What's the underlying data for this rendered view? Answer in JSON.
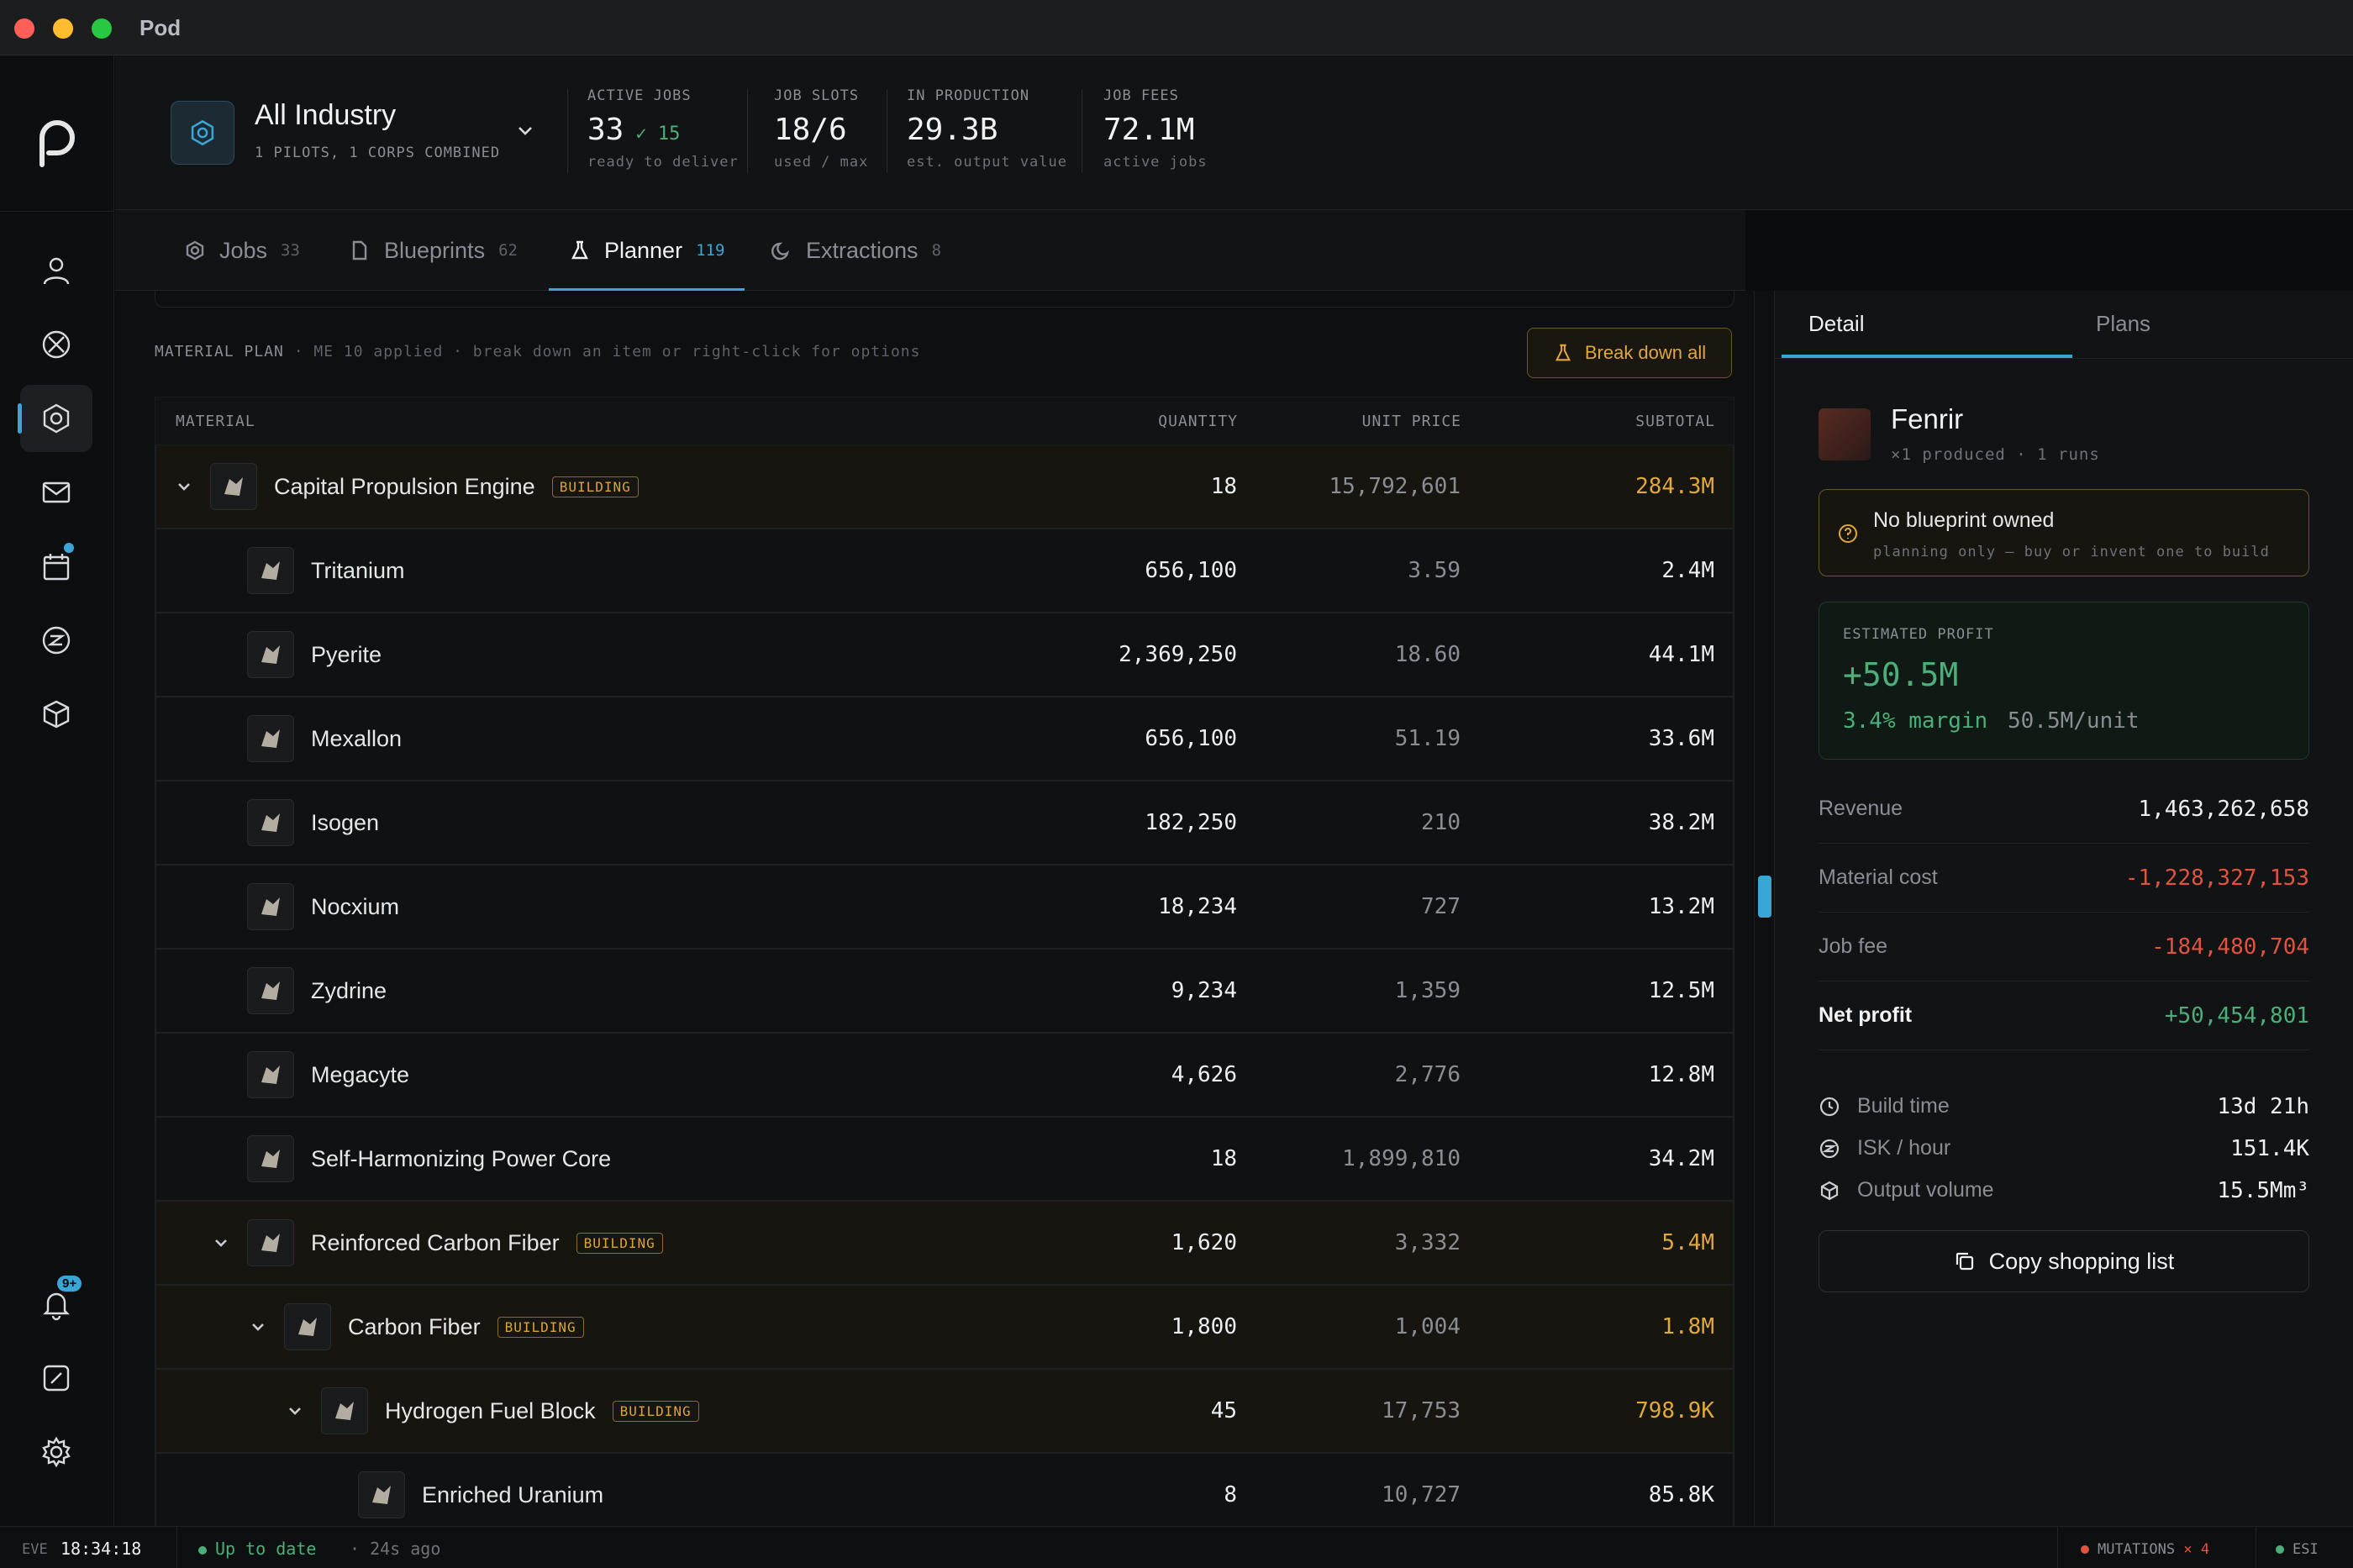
{
  "window": {
    "title": "Pod"
  },
  "header": {
    "scope_title": "All Industry",
    "scope_sub": "1 PILOTS, 1 CORPS COMBINED",
    "stats": [
      {
        "label": "ACTIVE JOBS",
        "value": "33",
        "extra": "✓ 15",
        "sub": "ready to deliver"
      },
      {
        "label": "JOB SLOTS",
        "value": "18/6",
        "sub": "used / max"
      },
      {
        "label": "IN PRODUCTION",
        "value": "29.3B",
        "sub": "est. output value"
      },
      {
        "label": "JOB FEES",
        "value": "72.1M",
        "sub": "active jobs"
      }
    ]
  },
  "tabs": [
    {
      "label": "Jobs",
      "count": "33",
      "icon": "gear-icon"
    },
    {
      "label": "Blueprints",
      "count": "62",
      "icon": "document-icon"
    },
    {
      "label": "Planner",
      "count": "119",
      "icon": "flask-icon",
      "active": true
    },
    {
      "label": "Extractions",
      "count": "8",
      "icon": "moon-icon"
    }
  ],
  "plan": {
    "caption_title": "MATERIAL PLAN",
    "caption_detail": "· ME 10 applied · break down an item or right-click for options",
    "breakdown_label": "Break down all",
    "columns": {
      "material": "MATERIAL",
      "quantity": "QUANTITY",
      "unit_price": "UNIT PRICE",
      "subtotal": "SUBTOTAL"
    },
    "building_tag": "BUILDING",
    "rows": [
      {
        "name": "Capital Propulsion Engine",
        "qty": "18",
        "price": "15,792,601",
        "subtotal": "284.3M",
        "level": 0,
        "building": true
      },
      {
        "name": "Tritanium",
        "qty": "656,100",
        "price": "3.59",
        "subtotal": "2.4M",
        "level": 1,
        "building": false
      },
      {
        "name": "Pyerite",
        "qty": "2,369,250",
        "price": "18.60",
        "subtotal": "44.1M",
        "level": 1,
        "building": false
      },
      {
        "name": "Mexallon",
        "qty": "656,100",
        "price": "51.19",
        "subtotal": "33.6M",
        "level": 1,
        "building": false
      },
      {
        "name": "Isogen",
        "qty": "182,250",
        "price": "210",
        "subtotal": "38.2M",
        "level": 1,
        "building": false
      },
      {
        "name": "Nocxium",
        "qty": "18,234",
        "price": "727",
        "subtotal": "13.2M",
        "level": 1,
        "building": false
      },
      {
        "name": "Zydrine",
        "qty": "9,234",
        "price": "1,359",
        "subtotal": "12.5M",
        "level": 1,
        "building": false
      },
      {
        "name": "Megacyte",
        "qty": "4,626",
        "price": "2,776",
        "subtotal": "12.8M",
        "level": 1,
        "building": false
      },
      {
        "name": "Self-Harmonizing Power Core",
        "qty": "18",
        "price": "1,899,810",
        "subtotal": "34.2M",
        "level": 1,
        "building": false
      },
      {
        "name": "Reinforced Carbon Fiber",
        "qty": "1,620",
        "price": "3,332",
        "subtotal": "5.4M",
        "level": 1,
        "building": true
      },
      {
        "name": "Carbon Fiber",
        "qty": "1,800",
        "price": "1,004",
        "subtotal": "1.8M",
        "level": 2,
        "building": true
      },
      {
        "name": "Hydrogen Fuel Block",
        "qty": "45",
        "price": "17,753",
        "subtotal": "798.9K",
        "level": 3,
        "building": true
      },
      {
        "name": "Enriched Uranium",
        "qty": "8",
        "price": "10,727",
        "subtotal": "85.8K",
        "level": 4,
        "building": false
      }
    ]
  },
  "panel": {
    "tabs": [
      "Detail",
      "Plans"
    ],
    "ship_name": "Fenrir",
    "ship_sub": "×1 produced · 1 runs",
    "warn_title": "No blueprint owned",
    "warn_sub": "planning only — buy or invent one to build",
    "profit_label": "ESTIMATED PROFIT",
    "profit_value": "+50.5M",
    "profit_margin": "3.4% margin",
    "profit_unit": "50.5M/unit",
    "lines": [
      {
        "label": "Revenue",
        "value": "1,463,262,658",
        "tone": "plain"
      },
      {
        "label": "Material cost",
        "value": "-1,228,327,153",
        "tone": "neg"
      },
      {
        "label": "Job fee",
        "value": "-184,480,704",
        "tone": "neg"
      },
      {
        "label": "Net profit",
        "value": "+50,454,801",
        "tone": "pos"
      }
    ],
    "metrics": [
      {
        "label": "Build time",
        "value": "13d 21h",
        "icon": "clock-icon"
      },
      {
        "label": "ISK / hour",
        "value": "151.4K",
        "icon": "isk-icon"
      },
      {
        "label": "Output volume",
        "value": "15.5Mm³",
        "icon": "cube-icon"
      }
    ],
    "copy_label": "Copy shopping list"
  },
  "statusbar": {
    "eve_label": "EVE",
    "time": "18:34:18",
    "sync_status": "Up to date",
    "sync_ago": "· 24s ago",
    "mutations_label": "MUTATIONS",
    "mutations_count": "× 4",
    "esi_label": "ESI"
  },
  "rail": {
    "notif_badge": "9+"
  },
  "colors": {
    "accent": "#3aa6d6",
    "building": "#e0a83c",
    "positive": "#4caf7a",
    "negative": "#e0533f"
  }
}
